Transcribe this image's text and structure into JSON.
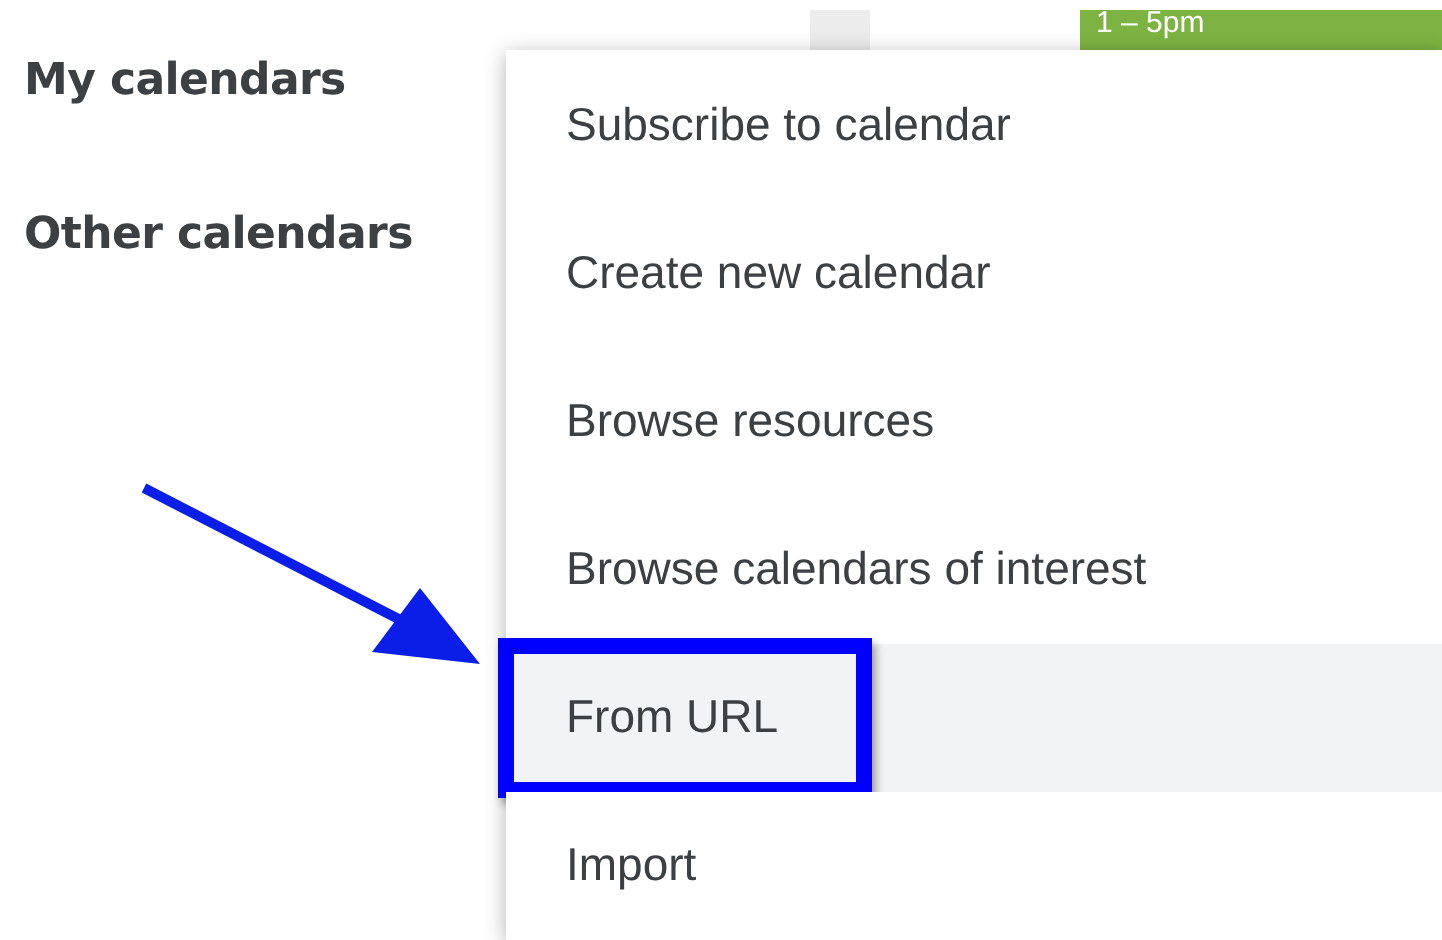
{
  "sidebar": {
    "sections": [
      "My calendars",
      "Other calendars"
    ]
  },
  "event": {
    "time": "1 – 5pm",
    "color": "#7cb342"
  },
  "menu": {
    "items": [
      {
        "label": "Subscribe to calendar",
        "selected": false,
        "annotated": false
      },
      {
        "label": "Create new calendar",
        "selected": false,
        "annotated": false
      },
      {
        "label": "Browse resources",
        "selected": false,
        "annotated": false
      },
      {
        "label": "Browse calendars of interest",
        "selected": false,
        "annotated": false
      },
      {
        "label": "From URL",
        "selected": true,
        "annotated": true
      },
      {
        "label": "Import",
        "selected": false,
        "annotated": false
      }
    ]
  }
}
